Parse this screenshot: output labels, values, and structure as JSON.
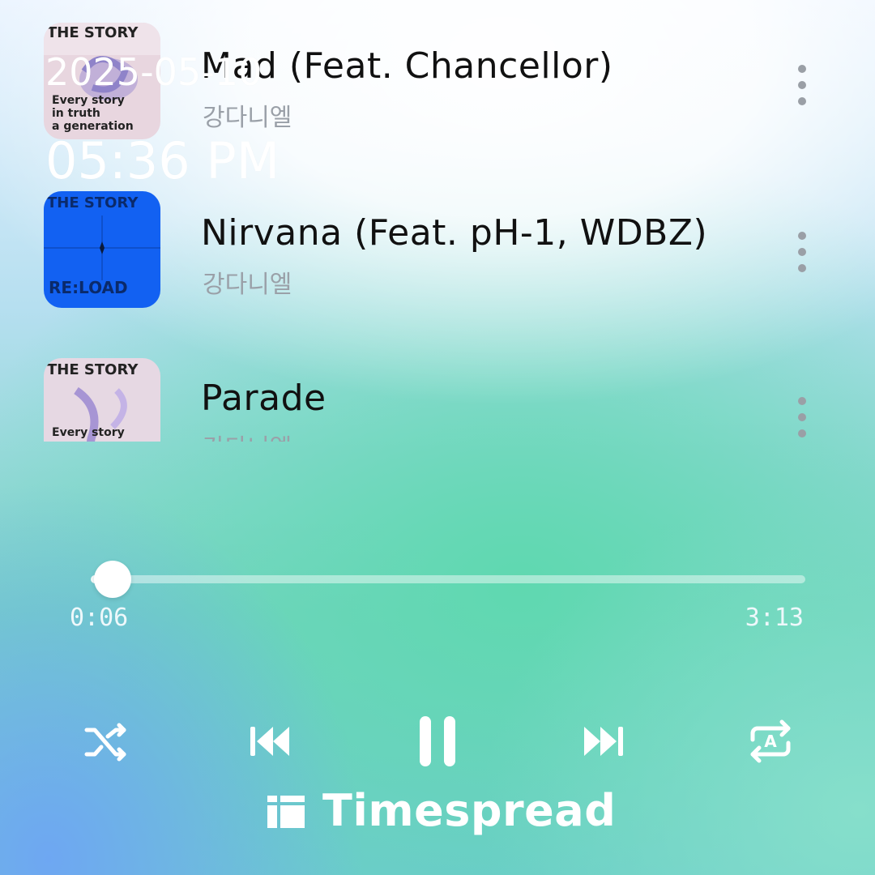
{
  "tracks": [
    {
      "title": "Mad (Feat. Chancellor)",
      "artist": "강다니엘",
      "album_art": "the-story-pink-cover"
    },
    {
      "title": "Nirvana (Feat. pH-1, WDBZ)",
      "artist": "강다니엘",
      "album_art": "the-story-blue-cover"
    },
    {
      "title": "Parade",
      "artist": "강다니엘",
      "album_art": "the-story-pink-cover"
    }
  ],
  "overlay": {
    "date": "2025-05-10",
    "time": "05:36 PM"
  },
  "player": {
    "elapsed": "0:06",
    "total": "3:13",
    "progress_fraction": 0.031,
    "controls": [
      "shuffle-icon",
      "previous-icon",
      "pause-icon",
      "next-icon",
      "repeat-icon"
    ]
  },
  "brand": {
    "name": "Timespread",
    "icon": "timespread-logo-icon"
  },
  "colors": {
    "accent": "#ffffff",
    "title": "#111111",
    "artist": "#9aa0a8",
    "blue_cover": "#1261f2"
  }
}
